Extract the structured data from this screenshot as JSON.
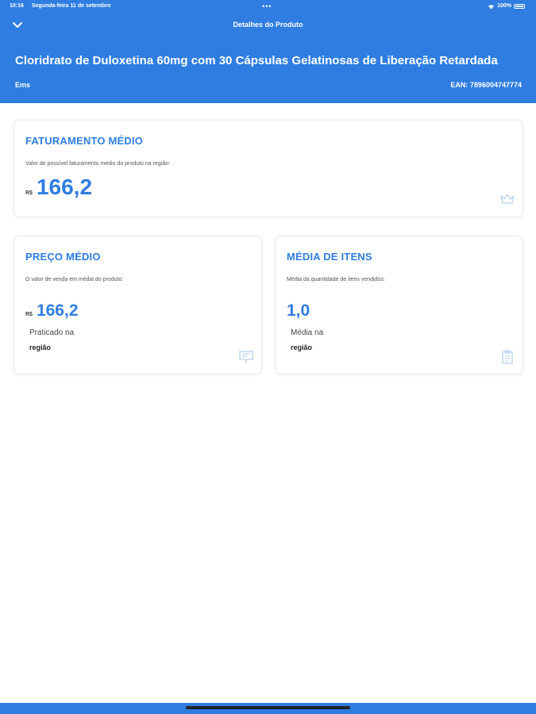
{
  "status_bar": {
    "time": "10:16",
    "date": "Segunda-feira 11 de setembro",
    "dots": "•••",
    "battery": "100%"
  },
  "nav": {
    "title": "Detalhes do Produto",
    "back_icon": "chevron-down-icon"
  },
  "product": {
    "name": "Cloridrato de Duloxetina 60mg com 30 Cápsulas Gelatinosas de Liberação Retardada",
    "manufacturer": "Ems",
    "ean_label": "EAN:",
    "ean_value": "7896004747774"
  },
  "cards": {
    "faturamento": {
      "title": "FATURAMENTO MÉDIO",
      "description": "Valor de possível faturamento médio do produto na região:",
      "currency": "R$",
      "value": "166,2",
      "icon": "crown-icon"
    },
    "preco": {
      "title": "PREÇO MÉDIO",
      "description": "O valor de venda em média do produto:",
      "currency": "R$",
      "value": "166,2",
      "sub_label_1": "Praticado na",
      "sub_label_2": "região",
      "icon": "presentation-board-icon"
    },
    "itens": {
      "title": "MÉDIA DE ITENS",
      "description": "Média da quantidade de itens vendidos:",
      "value": "1,0",
      "sub_label_1": "Média na",
      "sub_label_2": "região",
      "icon": "clipboard-icon"
    }
  },
  "colors": {
    "primary": "#2f7de1",
    "card_border": "#e6e9ef",
    "icon_muted": "#b9d3f3"
  }
}
